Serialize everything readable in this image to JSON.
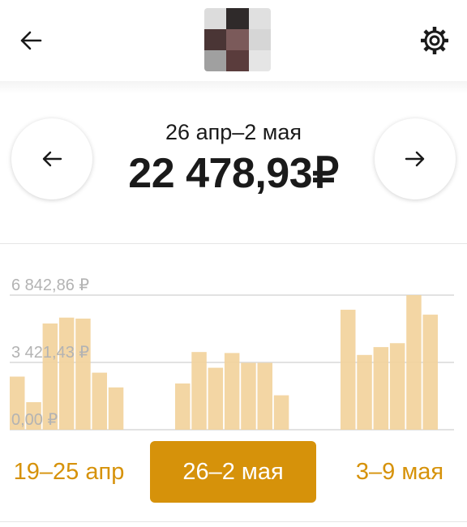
{
  "header": {
    "back_icon": "arrow-left-icon",
    "settings_icon": "gear-icon",
    "avatar_pixels": [
      "#dcdcdc",
      "#2f2a2a",
      "#e0e0e0",
      "#4a3535",
      "#7b5a5a",
      "#d6d6d6",
      "#a0a0a0",
      "#5a3c3c",
      "#e5e5e5"
    ]
  },
  "period": {
    "label": "26 апр–2 мая",
    "total": "22 478,93₽",
    "prev_icon": "arrow-left-icon",
    "next_icon": "arrow-right-icon"
  },
  "chart_data": {
    "type": "bar",
    "ytick_labels": [
      "6 842,86 ₽",
      "3 421,43 ₽",
      "0,00 ₽"
    ],
    "ylim": [
      0,
      6842.86
    ],
    "grid": true,
    "bar_color": "#f2d39c",
    "groups": [
      {
        "label": "19–25 апр",
        "values": [
          2700,
          1400,
          5400,
          5700,
          5650,
          2900,
          2150
        ]
      },
      {
        "label": "26–2 мая",
        "values": [
          2350,
          3950,
          3150,
          3900,
          3400,
          3400,
          1750
        ]
      },
      {
        "label": "3–9 мая",
        "values": [
          6100,
          3800,
          4200,
          4400,
          6842.86,
          5850
        ]
      }
    ]
  },
  "weeks": {
    "items": [
      "19–25 апр",
      "26–2 мая",
      "3–9 мая"
    ],
    "active_index": 1,
    "accent_color": "#d6920a"
  }
}
